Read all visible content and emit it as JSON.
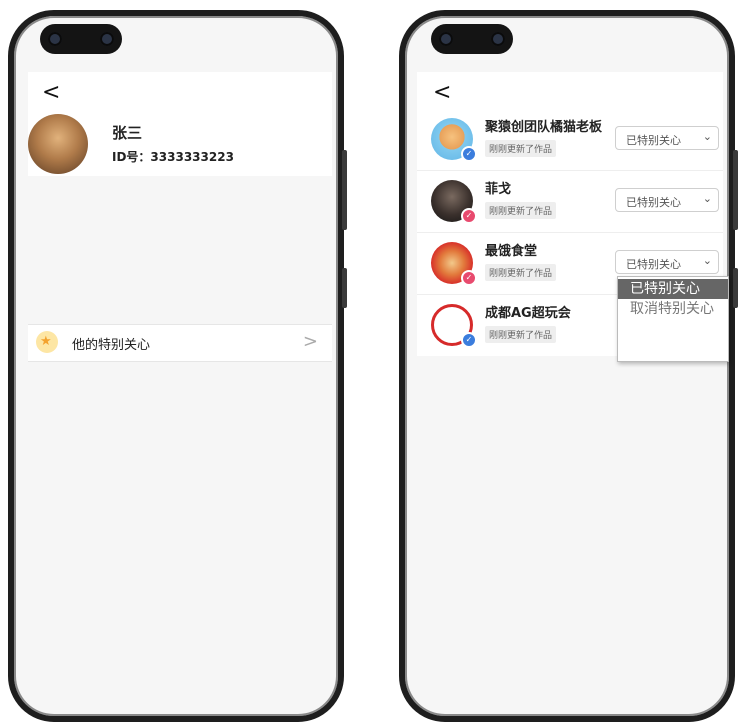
{
  "left_screen": {
    "back_label": "<",
    "profile": {
      "name": "张三",
      "id_text": "ID号：3333333223"
    },
    "special_row": {
      "label": "他的特别关心",
      "chevron": ">"
    }
  },
  "right_screen": {
    "back_label": "<",
    "items": [
      {
        "name": "聚猿创团队橘猫老板",
        "tag": "刚刚更新了作品",
        "select": "已特别关心",
        "badge_color": "#3b7ddd"
      },
      {
        "name": "菲戈",
        "tag": "刚刚更新了作品",
        "select": "已特别关心",
        "badge_color": "#e84a6e"
      },
      {
        "name": "最饿食堂",
        "tag": "刚刚更新了作品",
        "select": "已特别关心",
        "badge_color": "#e84a6e"
      },
      {
        "name": "成都AG超玩会",
        "tag": "刚刚更新了作品",
        "select": "",
        "badge_color": "#3b7ddd"
      }
    ],
    "dropdown": {
      "options": [
        "已特别关心",
        "取消特别关心"
      ]
    }
  },
  "colors": {
    "accent": "#f3a22e",
    "frame": "#1e1e1e"
  }
}
